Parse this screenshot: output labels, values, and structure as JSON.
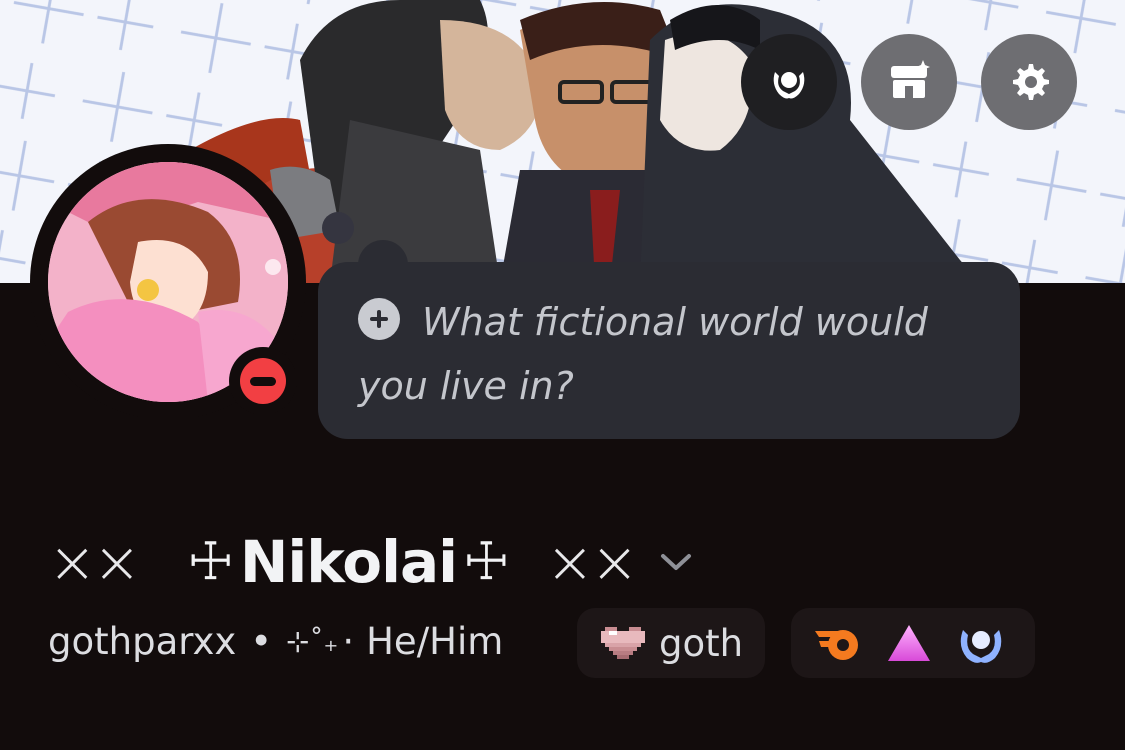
{
  "header_actions": {
    "nitro_icon": "laurel-wreath-icon",
    "shop_icon": "shop-storefront-icon",
    "settings_icon": "gear-icon"
  },
  "avatar": {
    "status": "do-not-disturb",
    "status_color": "#f23f43"
  },
  "status_bubble": {
    "icon": "plus-circle-icon",
    "prompt": "What fictional world would you live in?"
  },
  "profile": {
    "deco_left": "⨯⨯",
    "cross_left": "☩",
    "display_name": "Nikolai",
    "cross_right": "☩",
    "deco_right": "⨯⨯",
    "dropdown_icon": "chevron-down-icon",
    "username": "gothparxx",
    "separator": "•",
    "sparkle": "⊹˚₊",
    "sparkle_dot": "·",
    "pronouns": "He/Him",
    "tag": {
      "icon": "pixel-heart-icon",
      "label": "goth"
    },
    "badges": [
      "orange-swirl-badge-icon",
      "pink-triangle-badge-icon",
      "blue-laurel-badge-icon"
    ]
  },
  "colors": {
    "background": "#120c0c",
    "bubble": "#2b2c33",
    "accent_dnd": "#f23f43"
  }
}
